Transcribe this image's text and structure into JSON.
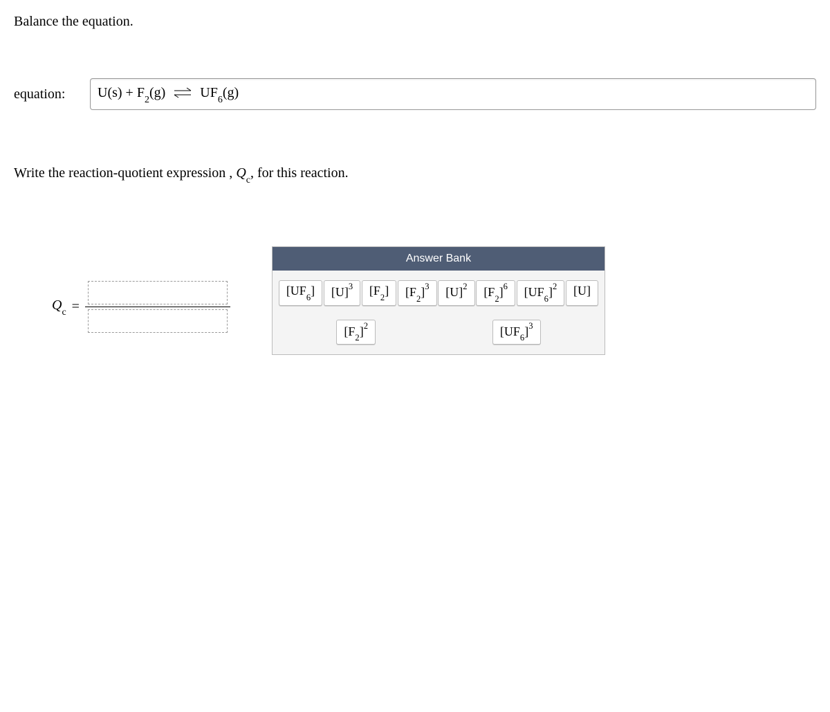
{
  "prompts": {
    "balance": "Balance the equation.",
    "write_qc_pre": "Write the reaction-quotient expression , ",
    "write_qc_var": "Q",
    "write_qc_varsub": "c",
    "write_qc_post": ", for this reaction."
  },
  "equation": {
    "label": "equation:",
    "value_parts": {
      "p1": "U(s) + F",
      "s1": "2",
      "p2": "(g)",
      "p3": "UF",
      "s2": "6",
      "p4": "(g)"
    }
  },
  "qc": {
    "var": "Q",
    "sub": "c",
    "eq": "="
  },
  "answer_bank": {
    "header": "Answer Bank",
    "tiles": [
      {
        "base": "[UF",
        "sub": "6",
        "close": "]",
        "sup": ""
      },
      {
        "base": "[U]",
        "sub": "",
        "close": "",
        "sup": "3"
      },
      {
        "base": "[F",
        "sub": "2",
        "close": "]",
        "sup": ""
      },
      {
        "base": "[F",
        "sub": "2",
        "close": "]",
        "sup": "3"
      },
      {
        "base": "[U]",
        "sub": "",
        "close": "",
        "sup": "2"
      },
      {
        "base": "[F",
        "sub": "2",
        "close": "]",
        "sup": "6"
      },
      {
        "base": "[UF",
        "sub": "6",
        "close": "]",
        "sup": "2"
      },
      {
        "base": "[U]",
        "sub": "",
        "close": "",
        "sup": ""
      },
      {
        "base": "[F",
        "sub": "2",
        "close": "]",
        "sup": "2"
      },
      {
        "base": "[UF",
        "sub": "6",
        "close": "]",
        "sup": "3"
      }
    ]
  }
}
